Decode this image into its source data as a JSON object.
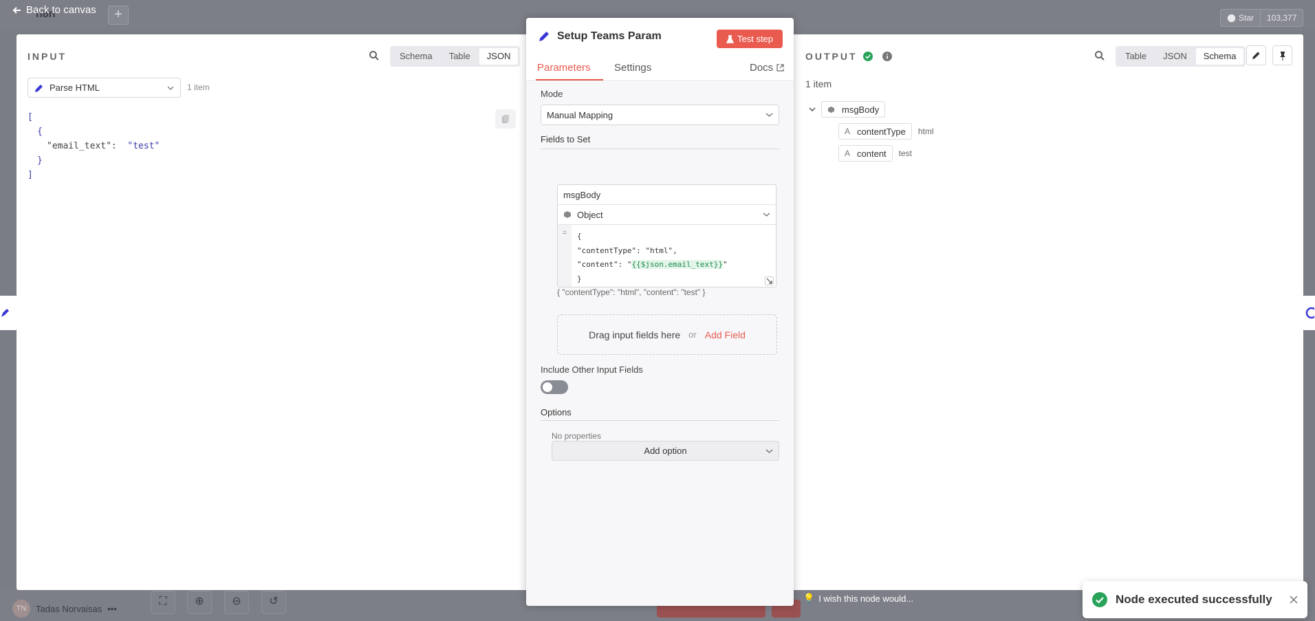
{
  "colors": {
    "accent": "#ea5b4f",
    "success": "#29a35a",
    "node_icon": "#3b39d6"
  },
  "canvas": {
    "back_label": "Back to canvas",
    "logo_text": "n8n",
    "github_star": "Star",
    "github_count": "103,377",
    "user_initials": "TN",
    "user_name": "Tadas Norvaisas",
    "wish_text": "I wish this node would..."
  },
  "input_panel": {
    "title": "INPUT",
    "tabs": [
      "Schema",
      "Table",
      "JSON"
    ],
    "active_tab": "JSON",
    "source_node": "Parse HTML",
    "item_count": "1 item",
    "json": {
      "open_bracket": "[",
      "open_brace": "{",
      "key": "\"email_text\":",
      "value": "\"test\"",
      "close_brace": "}",
      "close_bracket": "]"
    }
  },
  "node": {
    "title": "Setup Teams Param",
    "test_button": "Test step",
    "tabs": {
      "parameters": "Parameters",
      "settings": "Settings",
      "docs": "Docs"
    },
    "mode_label": "Mode",
    "mode_value": "Manual Mapping",
    "fields_label": "Fields to Set",
    "field": {
      "name": "msgBody",
      "type": "Object",
      "code_lines": [
        "{",
        "\"contentType\": \"html\",",
        "\"content\": \"",
        "{{$json.email_text}}",
        "\"",
        "}"
      ],
      "preview": "{ \"contentType\": \"html\", \"content\": \"test\" }"
    },
    "drop_zone": {
      "text": "Drag input fields here",
      "or": "or",
      "add": "Add Field"
    },
    "include_label": "Include Other Input Fields",
    "include_enabled": false,
    "options_label": "Options",
    "no_properties": "No properties",
    "add_option": "Add option"
  },
  "output_panel": {
    "title": "OUTPUT",
    "tabs": [
      "Table",
      "JSON",
      "Schema"
    ],
    "active_tab": "Schema",
    "item_count": "1 item",
    "root": "msgBody",
    "fields": [
      {
        "type": "A",
        "key": "contentType",
        "value": "html"
      },
      {
        "type": "A",
        "key": "content",
        "value": "test"
      }
    ]
  },
  "toast": {
    "message": "Node executed successfully"
  }
}
